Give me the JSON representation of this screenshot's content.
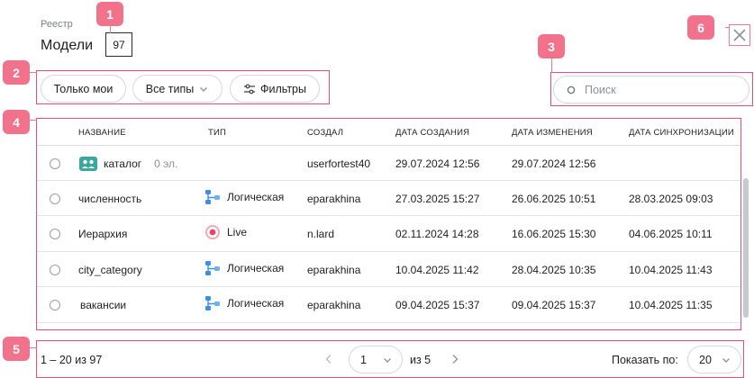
{
  "header": {
    "breadcrumb": "Реестр",
    "title": "Модели",
    "count": "97"
  },
  "toolbar": {
    "only_mine": "Только мои",
    "all_types": "Все типы",
    "filters": "Фильтры"
  },
  "search": {
    "placeholder": "Поиск"
  },
  "table": {
    "columns": [
      "НАЗВАНИЕ",
      "ТИП",
      "СОЗДАЛ",
      "ДАТА СОЗДАНИЯ",
      "ДАТА ИЗМЕНЕНИЯ",
      "ДАТА СИНХРОНИЗАЦИИ"
    ],
    "rows": [
      {
        "name": "каталог",
        "extra": "0 эл.",
        "icon": "catalog-folder-icon",
        "type": "",
        "type_icon": "",
        "created_by": "userfortest40",
        "created": "29.07.2024 12:56",
        "modified": "29.07.2024 12:56",
        "synced": ""
      },
      {
        "name": "численность",
        "extra": "",
        "icon": "",
        "type": "Логическая",
        "type_icon": "logical-model-icon",
        "created_by": "eparakhina",
        "created": "27.03.2025 15:27",
        "modified": "26.06.2025 10:51",
        "synced": "28.03.2025 09:03"
      },
      {
        "name": "Иерархия",
        "extra": "",
        "icon": "",
        "type": "Live",
        "type_icon": "live-model-icon",
        "created_by": "n.lard",
        "created": "02.11.2024 14:28",
        "modified": "16.06.2025 15:30",
        "synced": "04.06.2025 10:11"
      },
      {
        "name": "city_category",
        "extra": "",
        "icon": "",
        "type": "Логическая",
        "type_icon": "logical-model-icon",
        "created_by": "eparakhina",
        "created": "10.04.2025 11:42",
        "modified": "28.04.2025 10:35",
        "synced": "10.04.2025 11:43"
      },
      {
        "name": "вакансии",
        "extra": "",
        "icon": "",
        "type": "Логическая",
        "type_icon": "logical-model-icon",
        "created_by": "eparakhina",
        "created": "09.04.2025 15:37",
        "modified": "09.04.2025 15:37",
        "synced": "10.04.2025 11:35"
      }
    ]
  },
  "pagination": {
    "range": "1 – 20 из 97",
    "page": "1",
    "of_pages": "из 5",
    "show_by_label": "Показать по:",
    "page_size": "20"
  },
  "annotations": [
    "1",
    "2",
    "3",
    "4",
    "5",
    "6"
  ],
  "colors": {
    "annotation": "#f2728c",
    "frame": "#ea4d75",
    "logical_icon": "#3d8fe0",
    "live_icon": "#e8455e",
    "catalog_icon": "#3aa89c"
  }
}
